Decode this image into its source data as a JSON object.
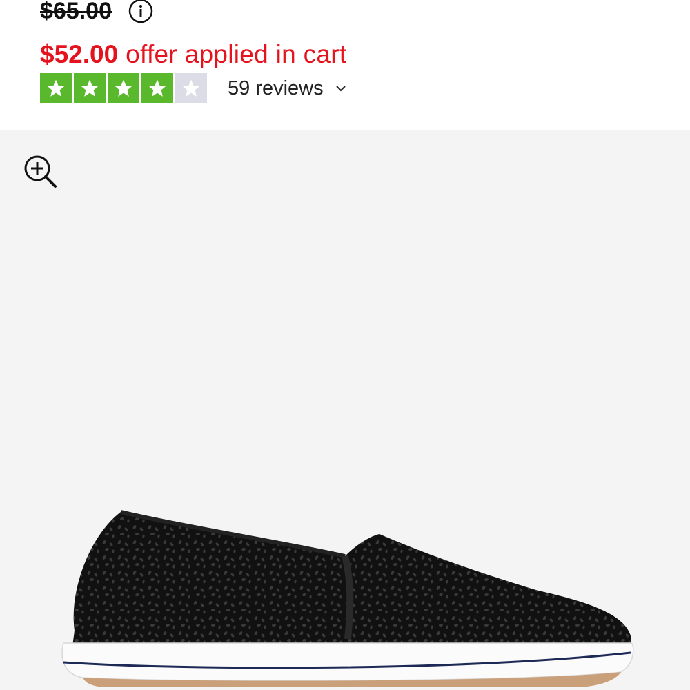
{
  "pricing": {
    "original_price": "$65.00",
    "sale_price": "$52.00",
    "offer_text": "offer applied in cart"
  },
  "rating": {
    "stars": 4,
    "max_stars": 5,
    "reviews_label": "59 reviews",
    "star_color": "#5ab82c",
    "empty_star_color": "#dcdce6"
  },
  "colors": {
    "sale_red": "#e5131d",
    "gallery_bg": "#f4f4f5"
  },
  "gallery": {
    "zoom_icon": "zoom-in-icon",
    "image_subject": "black perforated slip-on shoe"
  }
}
